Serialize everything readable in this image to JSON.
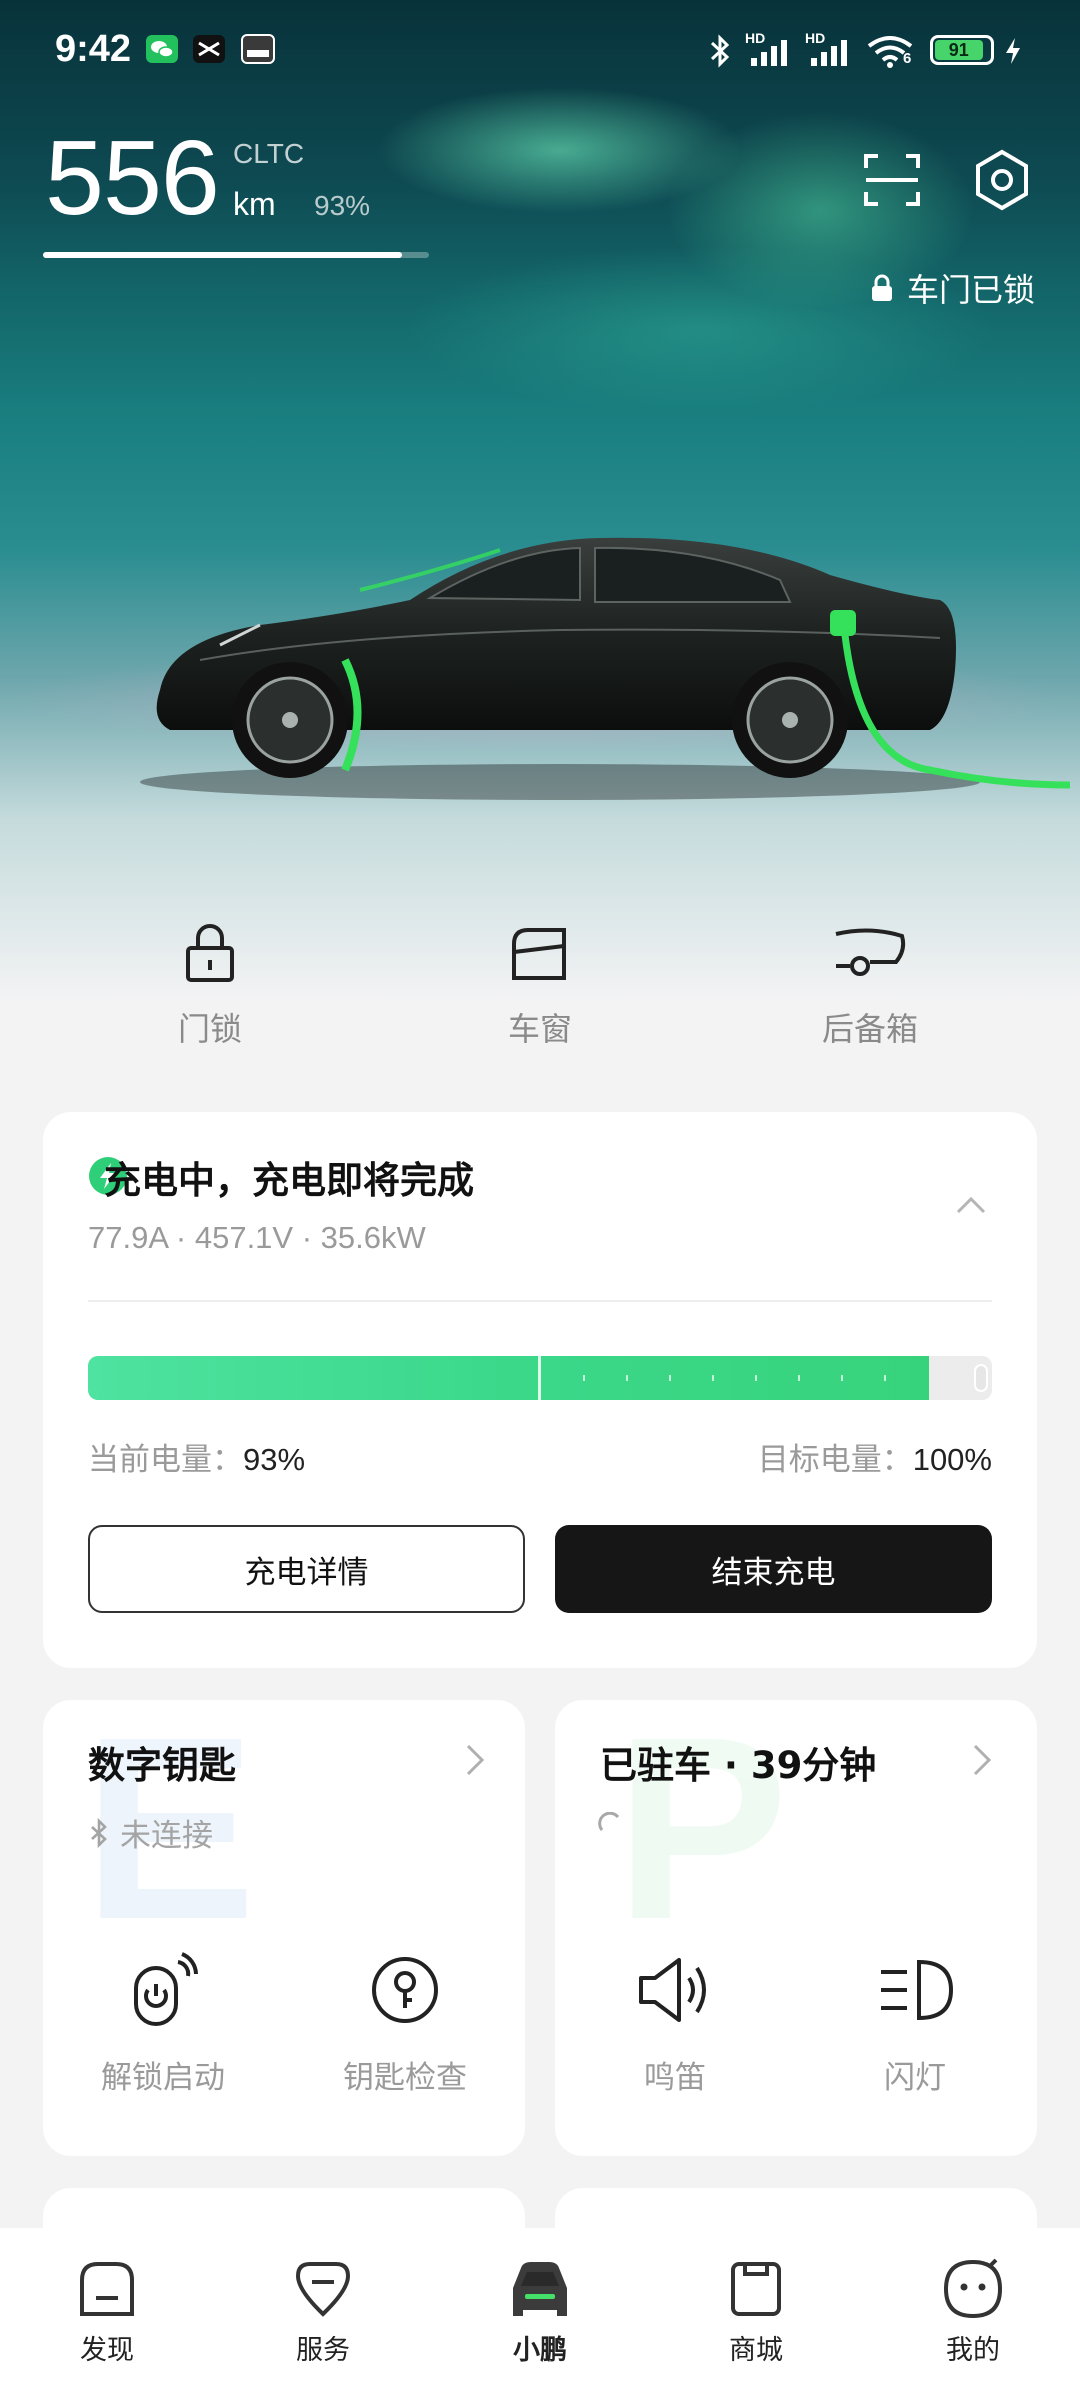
{
  "status_bar": {
    "time": "9:42",
    "battery": "91",
    "signal_1": "HD",
    "signal_2": "HD",
    "wifi": "6"
  },
  "vehicle": {
    "range": "556",
    "range_standard": "CLTC",
    "range_unit": "km",
    "battery_percent": "93%",
    "battery_fraction": 0.93,
    "door_status": "车门已锁"
  },
  "quick_controls": [
    {
      "label": "门锁",
      "icon": "padlock-icon"
    },
    {
      "label": "车窗",
      "icon": "car-window-icon"
    },
    {
      "label": "后备箱",
      "icon": "trunk-icon"
    }
  ],
  "charging": {
    "title": "充电中，充电即将完成",
    "metrics": "77.9A · 457.1V · 35.6kW",
    "current_label": "当前电量：",
    "current_value": "93%",
    "current_fraction": 0.93,
    "target_label": "目标电量：",
    "target_value": "100%",
    "detail_button": "充电详情",
    "stop_button": "结束充电",
    "accent": "#3bd88a"
  },
  "digital_key": {
    "title": "数字钥匙",
    "status": "未连接",
    "actions": [
      {
        "label": "解锁启动",
        "icon": "power-unlock-icon"
      },
      {
        "label": "钥匙检查",
        "icon": "key-check-icon"
      }
    ]
  },
  "parking": {
    "title": "已驻车 · 39分钟",
    "actions": [
      {
        "label": "鸣笛",
        "icon": "horn-icon"
      },
      {
        "label": "闪灯",
        "icon": "headlight-icon"
      }
    ]
  },
  "bottom_nav": [
    {
      "label": "发现",
      "icon": "discover-icon"
    },
    {
      "label": "服务",
      "icon": "service-icon"
    },
    {
      "label": "小鹏",
      "icon": "car-icon",
      "active": true
    },
    {
      "label": "商城",
      "icon": "shop-icon"
    },
    {
      "label": "我的",
      "icon": "profile-icon"
    }
  ]
}
